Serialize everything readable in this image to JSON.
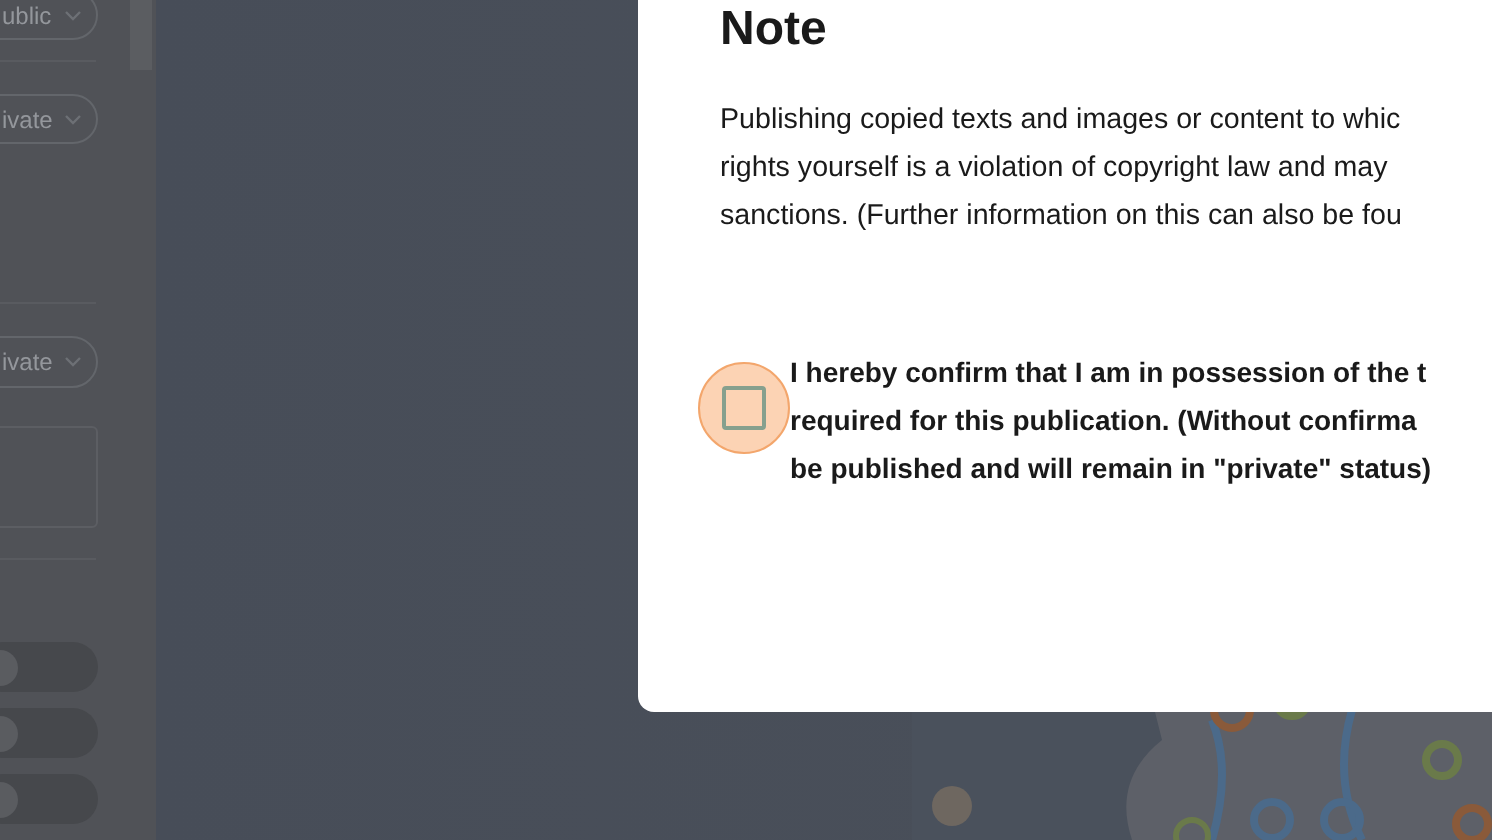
{
  "sidebar": {
    "dropdowns": [
      {
        "value": "ublic"
      },
      {
        "value": "ivate"
      },
      {
        "value": "ivate"
      }
    ],
    "toggles": [
      {
        "on": false
      },
      {
        "on": false
      },
      {
        "on": false
      }
    ]
  },
  "dialog": {
    "title": "Note",
    "paragraph_lines": [
      "Publishing copied texts and images or content to whic",
      "rights yourself is a violation of copyright law and may",
      "sanctions. (Further information on this can also be fou"
    ],
    "confirm": {
      "checked": false,
      "label_lines": [
        "I hereby confirm that I am in possession of the t",
        "required for this publication. (Without confirma",
        "be published and will remain in \"private\" status)"
      ]
    }
  }
}
